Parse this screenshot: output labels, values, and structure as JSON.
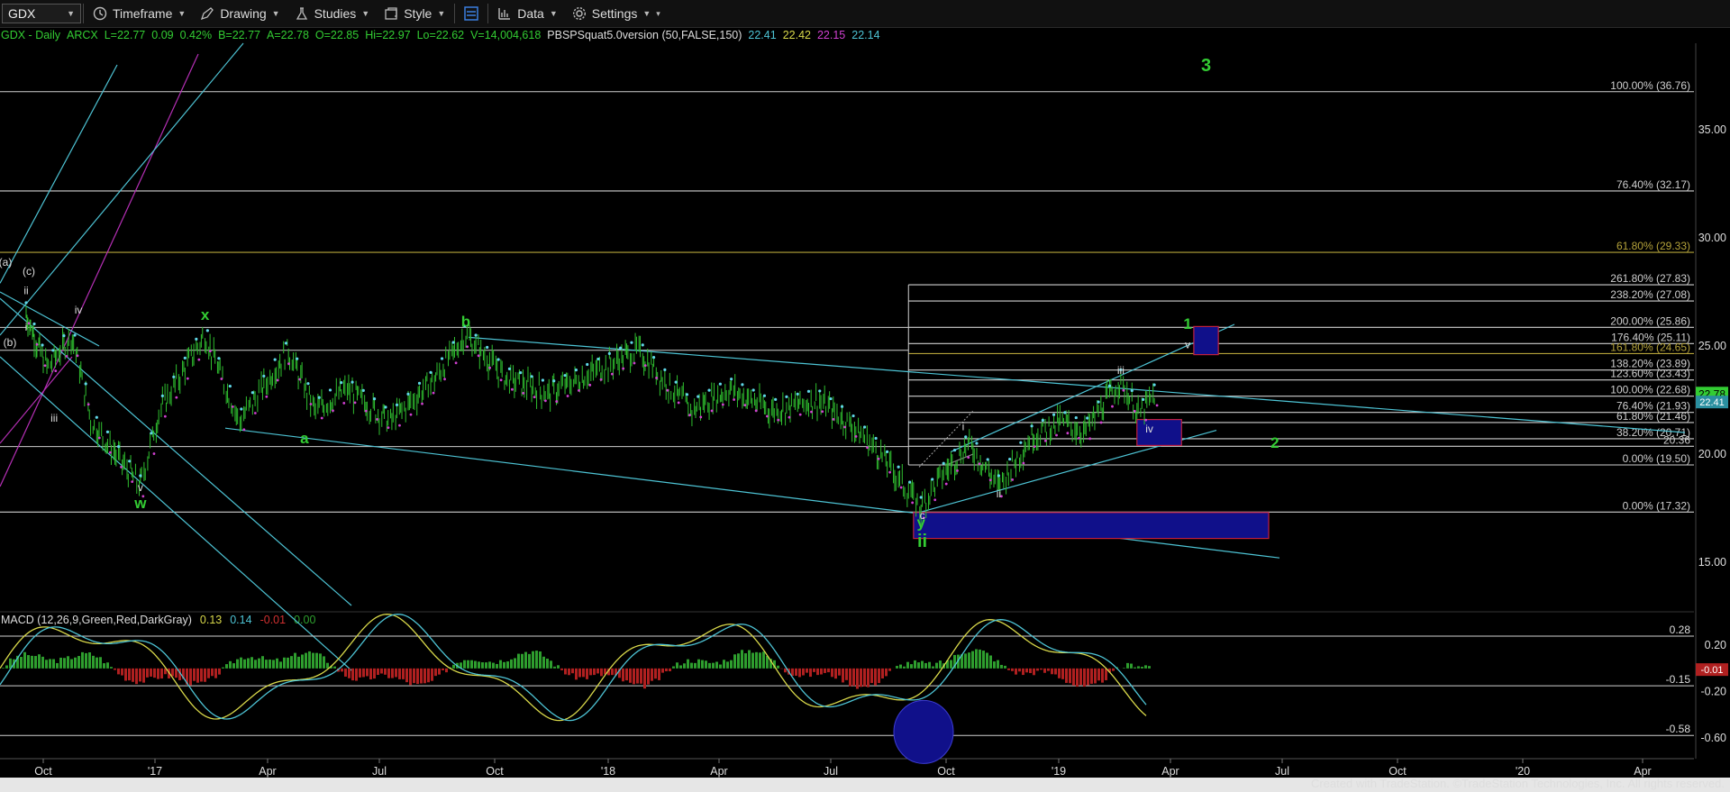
{
  "toolbar": {
    "symbol": "GDX",
    "items": [
      {
        "label": "Timeframe",
        "icon": "clock-icon"
      },
      {
        "label": "Drawing",
        "icon": "pencil-icon"
      },
      {
        "label": "Studies",
        "icon": "flask-icon"
      },
      {
        "label": "Style",
        "icon": "style-icon"
      },
      {
        "label": "",
        "icon": "layout-icon"
      },
      {
        "label": "Data",
        "icon": "bars-icon"
      },
      {
        "label": "Settings",
        "icon": "gear-icon"
      }
    ]
  },
  "legend": {
    "symbol": "GDX - Daily",
    "exchange": "ARCX",
    "last": "L=22.77",
    "change": "0.09",
    "pct": "0.42%",
    "bid": "B=22.77",
    "ask": "A=22.78",
    "open": "O=22.85",
    "high": "Hi=22.97",
    "low": "Lo=22.62",
    "volume": "V=14,004,618",
    "study": "PBSPSquat5.0version (50,FALSE,150)",
    "v1": "22.41",
    "v2": "22.42",
    "v3": "22.15",
    "v4": "22.14"
  },
  "macd_legend": {
    "name": "MACD (12,26,9,Green,Red,DarkGray)",
    "v1": "0.13",
    "v2": "0.14",
    "v3": "-0.01",
    "v4": "0.00"
  },
  "footer": "Created with TradeStation. ©TradeStation Technologies, Inc. All rights reserved.",
  "colors": {
    "background": "#000000",
    "green_label": "#33cc33",
    "price_bar": "#2fbf2f",
    "channel": "#4dc3d4",
    "magenta": "#b52fb5",
    "fib_line": "#bbbbbb",
    "target_box": "#10108a",
    "target_box_border": "#c02040",
    "last_price": "#33cc33",
    "macd_hist_pos": "#2e9e2e",
    "macd_hist_neg": "#b02020",
    "macd_line": "#d8d84a",
    "signal_line": "#4dc3d4"
  },
  "chart_data": {
    "type": "candlestick",
    "title": "GDX - Daily",
    "x_ticks": [
      "Oct",
      "'17",
      "Apr",
      "Jul",
      "Oct",
      "'18",
      "Apr",
      "Jul",
      "Oct",
      "'19",
      "Apr",
      "Jul",
      "Oct",
      "'20",
      "Apr"
    ],
    "price_axis": {
      "ticks": [
        "35.00",
        "30.00",
        "25.00",
        "20.00",
        "15.00"
      ],
      "range": [
        13,
        39
      ]
    },
    "last_price": "22.78",
    "right_badges": [
      "22.41"
    ],
    "price_series": {
      "name": "GDX",
      "dates": [
        "2016-09-12",
        "2016-10-05",
        "2016-10-25",
        "2016-11-10",
        "2016-12-20",
        "2017-01-05",
        "2017-02-10",
        "2017-03-10",
        "2017-04-18",
        "2017-05-10",
        "2017-06-05",
        "2017-07-10",
        "2017-08-15",
        "2017-09-08",
        "2017-10-10",
        "2017-11-15",
        "2018-01-25",
        "2018-03-10",
        "2018-04-10",
        "2018-05-15",
        "2018-06-20",
        "2018-07-15",
        "2018-08-10",
        "2018-09-11",
        "2018-09-25",
        "2018-10-20",
        "2018-11-13",
        "2018-12-10",
        "2019-01-03",
        "2019-01-22",
        "2019-02-20",
        "2019-03-07",
        "2019-03-20"
      ],
      "close": [
        26.5,
        24.0,
        25.5,
        21.5,
        18.5,
        22.0,
        25.5,
        21.5,
        24.8,
        22.0,
        23.0,
        21.5,
        23.5,
        25.5,
        23.5,
        22.8,
        24.8,
        22.0,
        23.0,
        22.0,
        22.5,
        21.5,
        20.0,
        17.5,
        18.8,
        20.5,
        18.5,
        20.8,
        21.5,
        21.0,
        23.4,
        21.8,
        22.78
      ]
    },
    "fib_levels": [
      {
        "label": "100.00% (36.76)",
        "value": 36.76
      },
      {
        "label": "76.40% (32.17)",
        "value": 32.17
      },
      {
        "label": "61.80% (29.33)",
        "value": 29.33
      },
      {
        "label": "261.80% (27.83)",
        "value": 27.83
      },
      {
        "label": "238.20% (27.08)",
        "value": 27.08
      },
      {
        "label": "200.00% (25.86)",
        "value": 25.86
      },
      {
        "label": "176.40% (25.11)",
        "value": 25.11
      },
      {
        "label": "161.80% (24.65)",
        "value": 24.65
      },
      {
        "label": "138.20% (23.89)",
        "value": 23.89
      },
      {
        "label": "123.60% (23.43)",
        "value": 23.43
      },
      {
        "label": "100.00% (22.68)",
        "value": 22.68
      },
      {
        "label": "76.40% (21.93)",
        "value": 21.93
      },
      {
        "label": "61.80% (21.46)",
        "value": 21.46
      },
      {
        "label": "38.20% (20.71)",
        "value": 20.71
      },
      {
        "label": "20.36",
        "value": 20.36
      },
      {
        "label": "0.00% (19.50)",
        "value": 19.5
      },
      {
        "label": "0.00% (17.32)",
        "value": 17.32
      }
    ],
    "wave_labels_green": [
      {
        "text": "3",
        "date": "2019-04-30",
        "price": 37.7,
        "large": true
      },
      {
        "text": "x",
        "date": "2017-02-10",
        "price": 26.2
      },
      {
        "text": "w",
        "date": "2016-12-20",
        "price": 17.5
      },
      {
        "text": "1",
        "date": "2019-04-15",
        "price": 25.8
      },
      {
        "text": "2",
        "date": "2019-06-25",
        "price": 20.3
      },
      {
        "text": "y",
        "date": "2018-09-11",
        "price": 16.6
      },
      {
        "text": "ii",
        "date": "2018-09-12",
        "price": 15.7,
        "large": true
      },
      {
        "text": "b",
        "date": "2017-09-08",
        "price": 25.9
      },
      {
        "text": "a",
        "date": "2017-05-01",
        "price": 20.5
      }
    ],
    "wave_labels_white": [
      {
        "text": "(a)",
        "date": "2016-08-20",
        "price": 28.7
      },
      {
        "text": "(c)",
        "date": "2016-09-15",
        "price": 28.3
      },
      {
        "text": "ii",
        "date": "2016-09-12",
        "price": 27.4
      },
      {
        "text": "i",
        "date": "2016-09-12",
        "price": 25.7
      },
      {
        "text": "(b)",
        "date": "2016-08-25",
        "price": 25.0
      },
      {
        "text": "iv",
        "date": "2016-10-30",
        "price": 26.5
      },
      {
        "text": "iii",
        "date": "2016-10-10",
        "price": 21.5
      },
      {
        "text": "v",
        "date": "2016-12-20",
        "price": 18.3
      },
      {
        "text": "c",
        "date": "2018-09-12",
        "price": 17.0
      },
      {
        "text": "i",
        "date": "2018-10-15",
        "price": 21.1
      },
      {
        "text": "ii",
        "date": "2018-11-13",
        "price": 18.0
      },
      {
        "text": "iii",
        "date": "2019-02-20",
        "price": 23.7
      },
      {
        "text": "iv",
        "date": "2019-03-15",
        "price": 21.0
      },
      {
        "text": "v",
        "date": "2019-04-15",
        "price": 24.9
      }
    ],
    "target_boxes": [
      {
        "name": "target-box-1",
        "from": "2019-04-20",
        "to": "2019-05-10",
        "low": 24.6,
        "high": 25.9
      },
      {
        "name": "target-box-iv",
        "from": "2019-03-05",
        "to": "2019-04-10",
        "low": 20.4,
        "high": 21.6
      },
      {
        "name": "target-box-ii",
        "from": "2018-09-05",
        "to": "2019-06-20",
        "low": 16.1,
        "high": 17.3
      }
    ],
    "macd": {
      "axis_ticks": [
        "0.20",
        "-0.20",
        "-0.60"
      ],
      "ref_levels": [
        "0.28",
        "-0.15",
        "-0.58"
      ],
      "last_badge": "-0.01",
      "range": [
        -0.75,
        0.42
      ]
    }
  }
}
